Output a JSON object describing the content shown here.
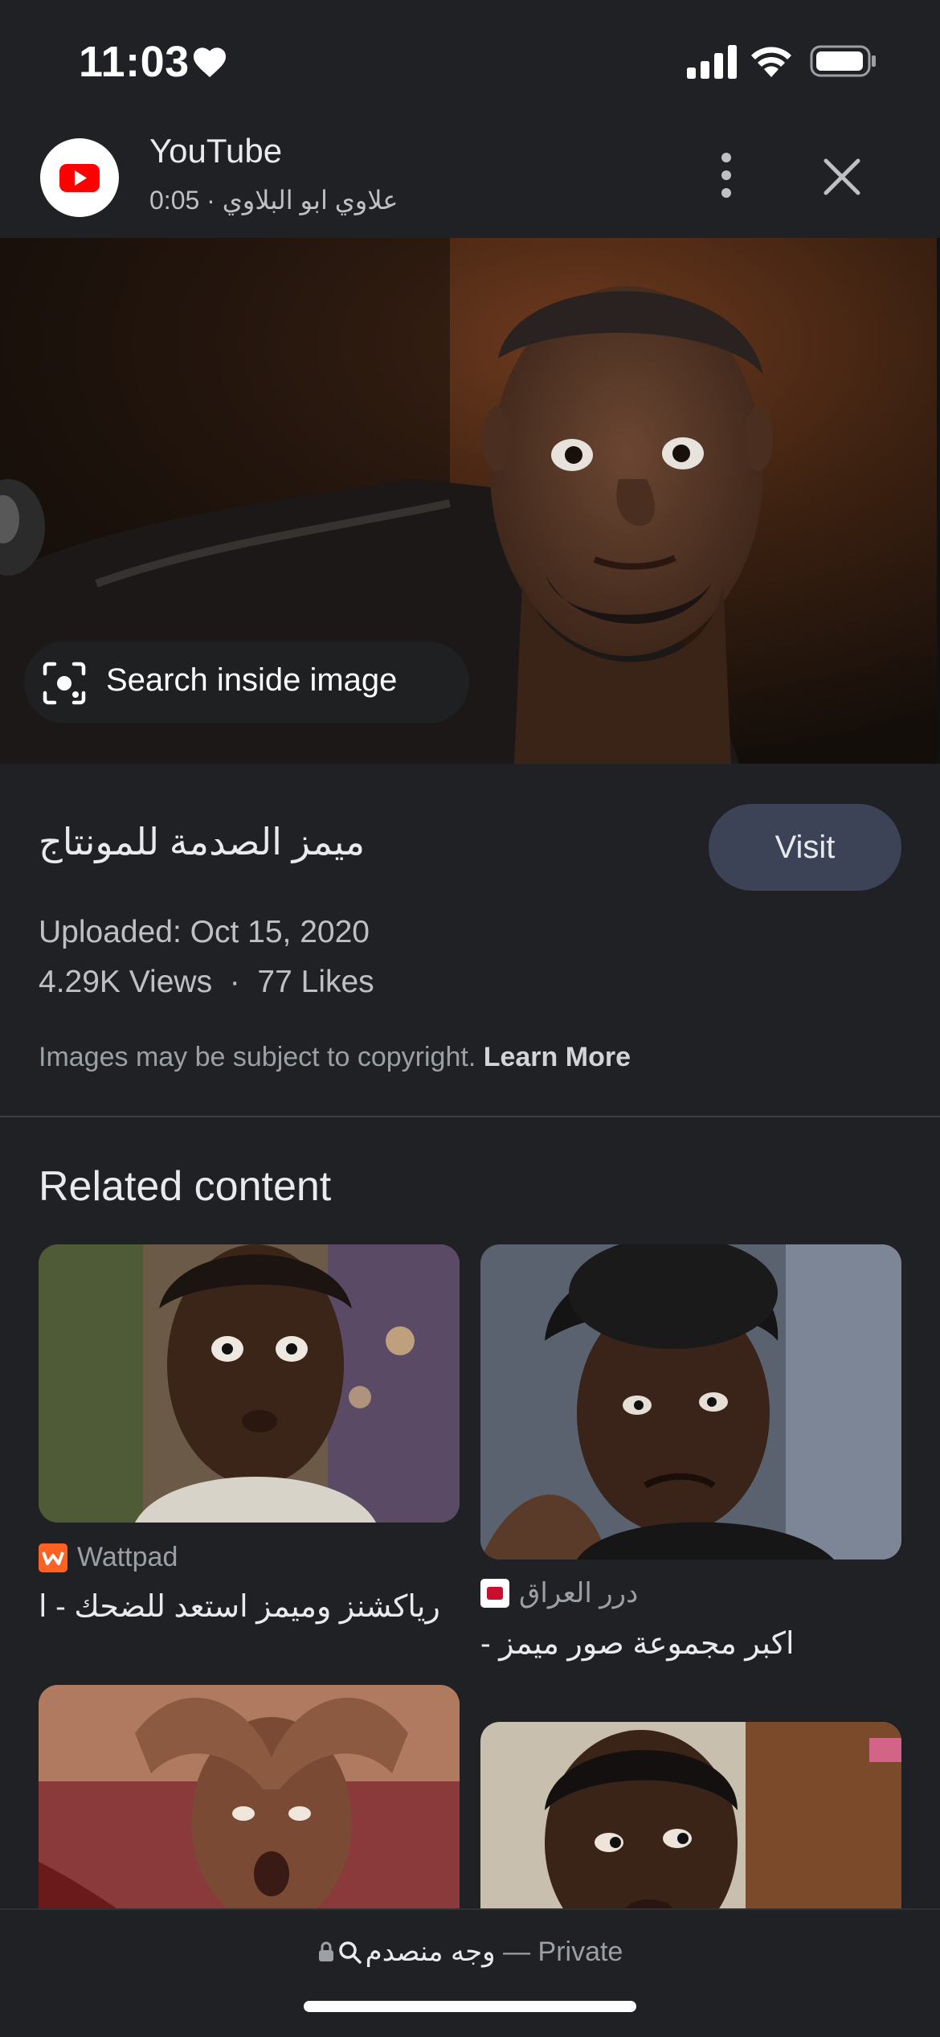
{
  "status_bar": {
    "time": "11:03"
  },
  "header": {
    "title": "YouTube",
    "subtitle": "0:05 · علاوي ابو البلاوي"
  },
  "hero": {
    "search_inside_label": "Search inside image"
  },
  "details": {
    "title": "ميمز الصدمة للمونتاج",
    "visit_label": "Visit",
    "uploaded": "Uploaded: Oct 15, 2020",
    "stats": "4.29K Views  ·  77 Likes",
    "copyright_text": "Images may be subject to copyright.",
    "learn_more": "Learn More"
  },
  "related": {
    "heading": "Related content",
    "items": [
      {
        "source": "Wattpad",
        "caption": "رياكشنز وميمز استعد للضحك - ا",
        "source_color": "#ff6122"
      },
      {
        "source": "درر العراق",
        "caption": "اكبر مجموعة صور ميمز -",
        "source_color": "#c8102e"
      },
      {
        "source": "",
        "caption": ""
      },
      {
        "source": "",
        "caption": ""
      }
    ]
  },
  "bottom_bar": {
    "query": "وجه منصدم",
    "separator": "—",
    "mode": "Private"
  },
  "colors": {
    "background": "#202124",
    "visit_button": "#3c4356",
    "youtube_red": "#ff0000"
  }
}
